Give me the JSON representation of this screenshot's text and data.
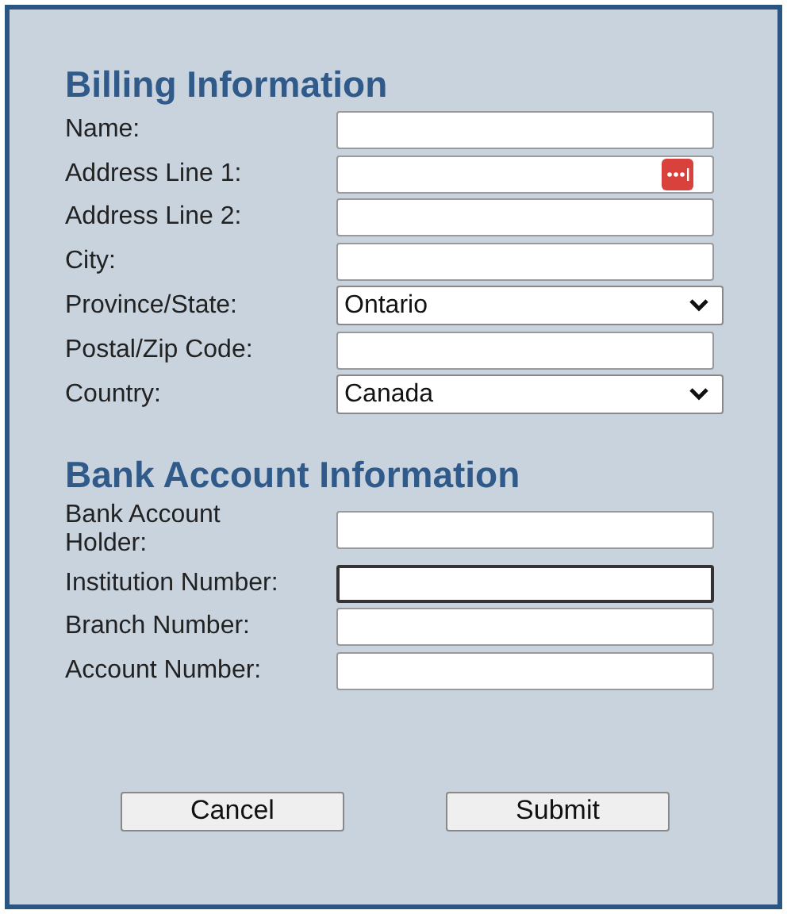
{
  "sections": [
    {
      "heading": "Billing Information",
      "fields": [
        {
          "label": "Name:",
          "kind": "text",
          "focused": false
        },
        {
          "label": "Address Line 1:",
          "kind": "text",
          "focused": false,
          "autofill_icon": true
        },
        {
          "label": "Address Line 2:",
          "kind": "text",
          "focused": false
        },
        {
          "label": "City:",
          "kind": "text",
          "focused": false
        },
        {
          "label": "Province/State:",
          "kind": "select",
          "value": "Ontario",
          "focused": false
        },
        {
          "label": "Postal/Zip Code:",
          "kind": "text",
          "focused": false
        },
        {
          "label": "Country:",
          "kind": "select",
          "value": "Canada",
          "focused": false
        }
      ]
    },
    {
      "heading": "Bank Account Information",
      "fields": [
        {
          "label": "Bank Account Holder:",
          "kind": "text",
          "focused": false
        },
        {
          "label": "Institution Number:",
          "kind": "text",
          "focused": true
        },
        {
          "label": "Branch Number:",
          "kind": "text",
          "focused": false
        },
        {
          "label": "Account Number:",
          "kind": "text",
          "focused": false
        }
      ]
    }
  ],
  "buttons": [
    "Cancel",
    "Submit"
  ]
}
